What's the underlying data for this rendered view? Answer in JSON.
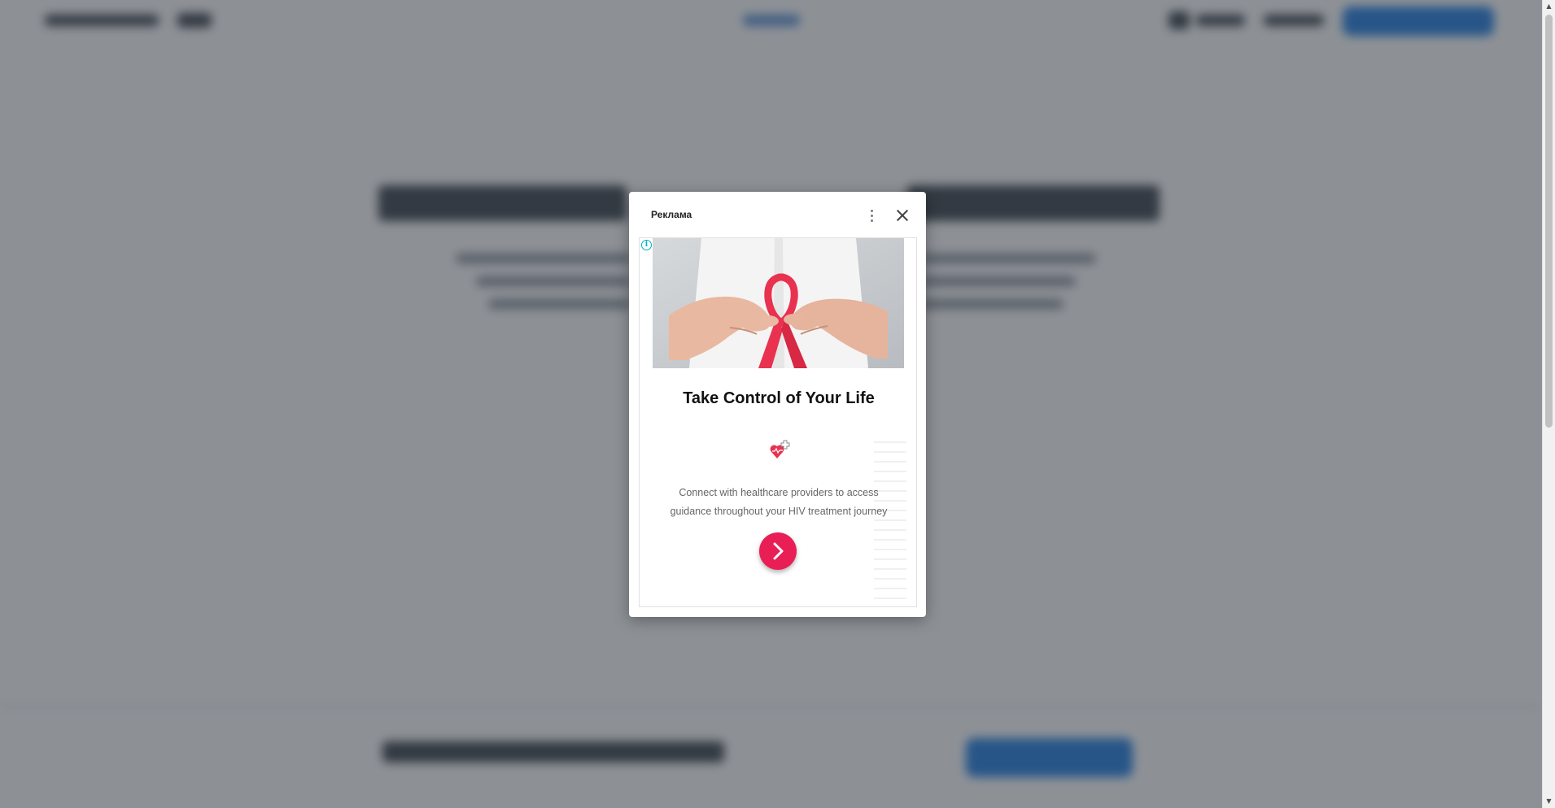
{
  "ad": {
    "label": "Реклама",
    "headline": "Take Control of Your Life",
    "description": "Connect with healthcare providers to access guidance throughout your HIV treatment journey",
    "info_icon": "i",
    "menu_icon": "vertical-dots-icon",
    "close_icon": "close-icon",
    "cta_icon": "chevron-right-icon",
    "image": "hands-holding-red-ribbon",
    "logo_icon": "heart-plus-icon"
  },
  "colors": {
    "cta": "#e91e55",
    "ribbon": "#e8324f",
    "info": "#00aecd",
    "background_button": "#1e7be0",
    "overlay": "rgba(48,54,63,0.55)"
  }
}
